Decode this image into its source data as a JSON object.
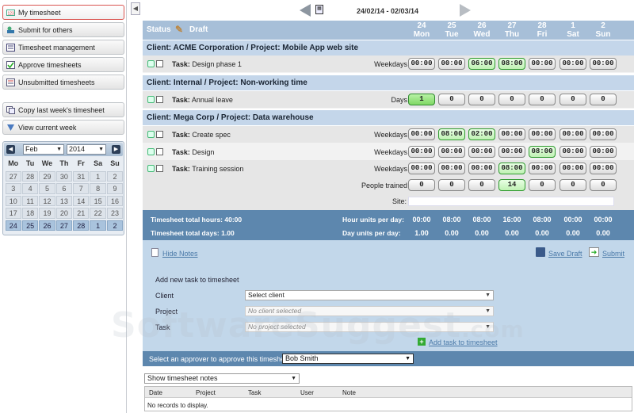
{
  "sidebar": {
    "nav": [
      {
        "label": "My timesheet",
        "icon": "timesheet-icon"
      },
      {
        "label": "Submit for others",
        "icon": "users-icon"
      },
      {
        "label": "Timesheet management",
        "icon": "manage-icon"
      },
      {
        "label": "Approve timesheets",
        "icon": "approve-icon"
      },
      {
        "label": "Unsubmitted timesheets",
        "icon": "unsubmitted-icon"
      }
    ],
    "actions": [
      {
        "label": "Copy last week's timesheet",
        "icon": "copy-icon"
      },
      {
        "label": "View current week",
        "icon": "view-week-icon"
      }
    ],
    "calendar": {
      "month": "Feb",
      "year": "2014",
      "weekdays": [
        "Mo",
        "Tu",
        "We",
        "Th",
        "Fr",
        "Sa",
        "Su"
      ],
      "weeks": [
        [
          "27",
          "28",
          "29",
          "30",
          "31",
          "1",
          "2"
        ],
        [
          "3",
          "4",
          "5",
          "6",
          "7",
          "8",
          "9"
        ],
        [
          "10",
          "11",
          "12",
          "13",
          "14",
          "15",
          "16"
        ],
        [
          "17",
          "18",
          "19",
          "20",
          "21",
          "22",
          "23"
        ],
        [
          "24",
          "25",
          "26",
          "27",
          "28",
          "1",
          "2"
        ]
      ]
    }
  },
  "header": {
    "week_range": "24/02/14 - 02/03/14",
    "status_label": "Status",
    "status_value": "Draft",
    "days": [
      {
        "num": "24",
        "name": "Mon"
      },
      {
        "num": "25",
        "name": "Tue"
      },
      {
        "num": "26",
        "name": "Wed"
      },
      {
        "num": "27",
        "name": "Thu"
      },
      {
        "num": "28",
        "name": "Fri"
      },
      {
        "num": "1",
        "name": "Sat"
      },
      {
        "num": "2",
        "name": "Sun"
      }
    ]
  },
  "grid": {
    "task_prefix": "Task:",
    "clients": [
      {
        "title": "Client: ACME Corporation / Project: Mobile App web site"
      },
      {
        "title": "Client: Internal / Project: Non-working time"
      },
      {
        "title": "Client: Mega Corp / Project: Data warehouse"
      }
    ],
    "rows": [
      {
        "task": "Design phase 1",
        "type": "Weekdays",
        "values": [
          "00:00",
          "00:00",
          "06:00",
          "08:00",
          "00:00",
          "00:00",
          "00:00"
        ],
        "states": [
          "n",
          "n",
          "g",
          "g",
          "n",
          "n",
          "n"
        ]
      },
      {
        "task": "Annual leave",
        "type": "Days",
        "values": [
          "1",
          "0",
          "0",
          "0",
          "0",
          "0",
          "0"
        ],
        "states": [
          "f",
          "n",
          "n",
          "n",
          "n",
          "n",
          "n"
        ]
      },
      {
        "task": "Create spec",
        "type": "Weekdays",
        "values": [
          "00:00",
          "08:00",
          "02:00",
          "00:00",
          "00:00",
          "00:00",
          "00:00"
        ],
        "states": [
          "n",
          "g",
          "g",
          "n",
          "n",
          "n",
          "n"
        ]
      },
      {
        "task": "Design",
        "type": "Weekdays",
        "values": [
          "00:00",
          "00:00",
          "00:00",
          "00:00",
          "08:00",
          "00:00",
          "00:00"
        ],
        "states": [
          "n",
          "n",
          "n",
          "n",
          "g",
          "n",
          "n"
        ]
      },
      {
        "task": "Training session",
        "type": "Weekdays",
        "values": [
          "00:00",
          "00:00",
          "00:00",
          "08:00",
          "00:00",
          "00:00",
          "00:00"
        ],
        "states": [
          "n",
          "n",
          "n",
          "g",
          "n",
          "n",
          "n"
        ]
      }
    ],
    "people_trained": {
      "label": "People trained",
      "values": [
        "0",
        "0",
        "0",
        "14",
        "0",
        "0",
        "0"
      ],
      "states": [
        "n",
        "n",
        "n",
        "g",
        "n",
        "n",
        "n"
      ]
    },
    "site_label": "Site:"
  },
  "totals": {
    "total_hours_label": "Timesheet total hours: 40:00",
    "total_days_label": "Timesheet total days: 1.00",
    "hour_units_label": "Hour units per day:",
    "day_units_label": "Day units per day:",
    "hour_units": [
      "00:00",
      "08:00",
      "08:00",
      "16:00",
      "08:00",
      "00:00",
      "00:00"
    ],
    "day_units": [
      "1.00",
      "0.00",
      "0.00",
      "0.00",
      "0.00",
      "0.00",
      "0.00"
    ]
  },
  "notes_section": {
    "hide_notes": "Hide Notes",
    "save_draft": "Save Draft",
    "submit": "Submit",
    "add_task_title": "Add new task to timesheet",
    "client_label": "Client",
    "project_label": "Project",
    "task_label": "Task",
    "client_value": "Select client",
    "project_value": "No client selected",
    "task_value": "No project selected",
    "add_task_link": "Add task to timesheet"
  },
  "approver": {
    "label": "Select an approver to approve this timesheet:",
    "value": "Bob Smith"
  },
  "notes_table": {
    "filter_value": "Show timesheet notes",
    "columns": [
      "Date",
      "Project",
      "Task",
      "User",
      "Note"
    ],
    "empty": "No records to display."
  },
  "watermark": {
    "text": "SoftwareSuggest",
    "suffix": ".com"
  }
}
